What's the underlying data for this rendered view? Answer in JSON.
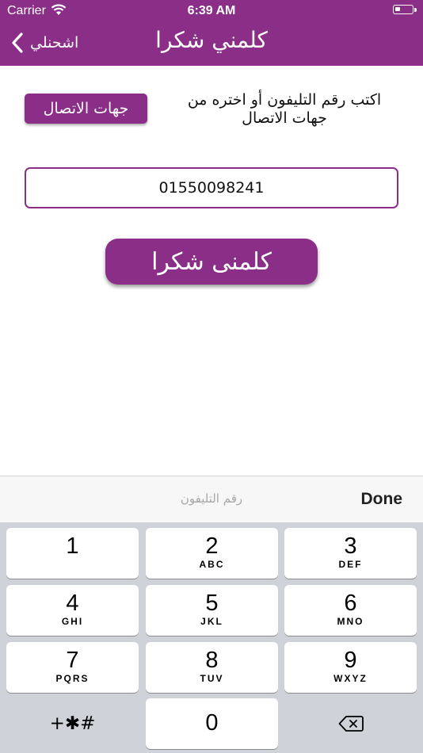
{
  "status_bar": {
    "carrier": "Carrier",
    "time": "6:39 AM"
  },
  "nav": {
    "back_label": "اشحنلي",
    "title": "كلمني شكرا"
  },
  "form": {
    "instructions": "اكتب رقم التليفون أو اختره من جهات الاتصال",
    "contacts_button": "جهات الاتصال",
    "phone_value": "01550098241",
    "call_button": "كلمنى شكرا"
  },
  "keyboard_accessory": {
    "hint": "رقم التليفون",
    "done_label": "Done"
  },
  "keypad": {
    "keys": [
      {
        "digit": "1",
        "letters": ""
      },
      {
        "digit": "2",
        "letters": "ABC"
      },
      {
        "digit": "3",
        "letters": "DEF"
      },
      {
        "digit": "4",
        "letters": "GHI"
      },
      {
        "digit": "5",
        "letters": "JKL"
      },
      {
        "digit": "6",
        "letters": "MNO"
      },
      {
        "digit": "7",
        "letters": "PQRS"
      },
      {
        "digit": "8",
        "letters": "TUV"
      },
      {
        "digit": "9",
        "letters": "WXYZ"
      }
    ],
    "symbols": "+✱#",
    "zero": "0"
  },
  "colors": {
    "brand": "#8a2e88",
    "keyboard_bg": "#cfd3d9"
  }
}
